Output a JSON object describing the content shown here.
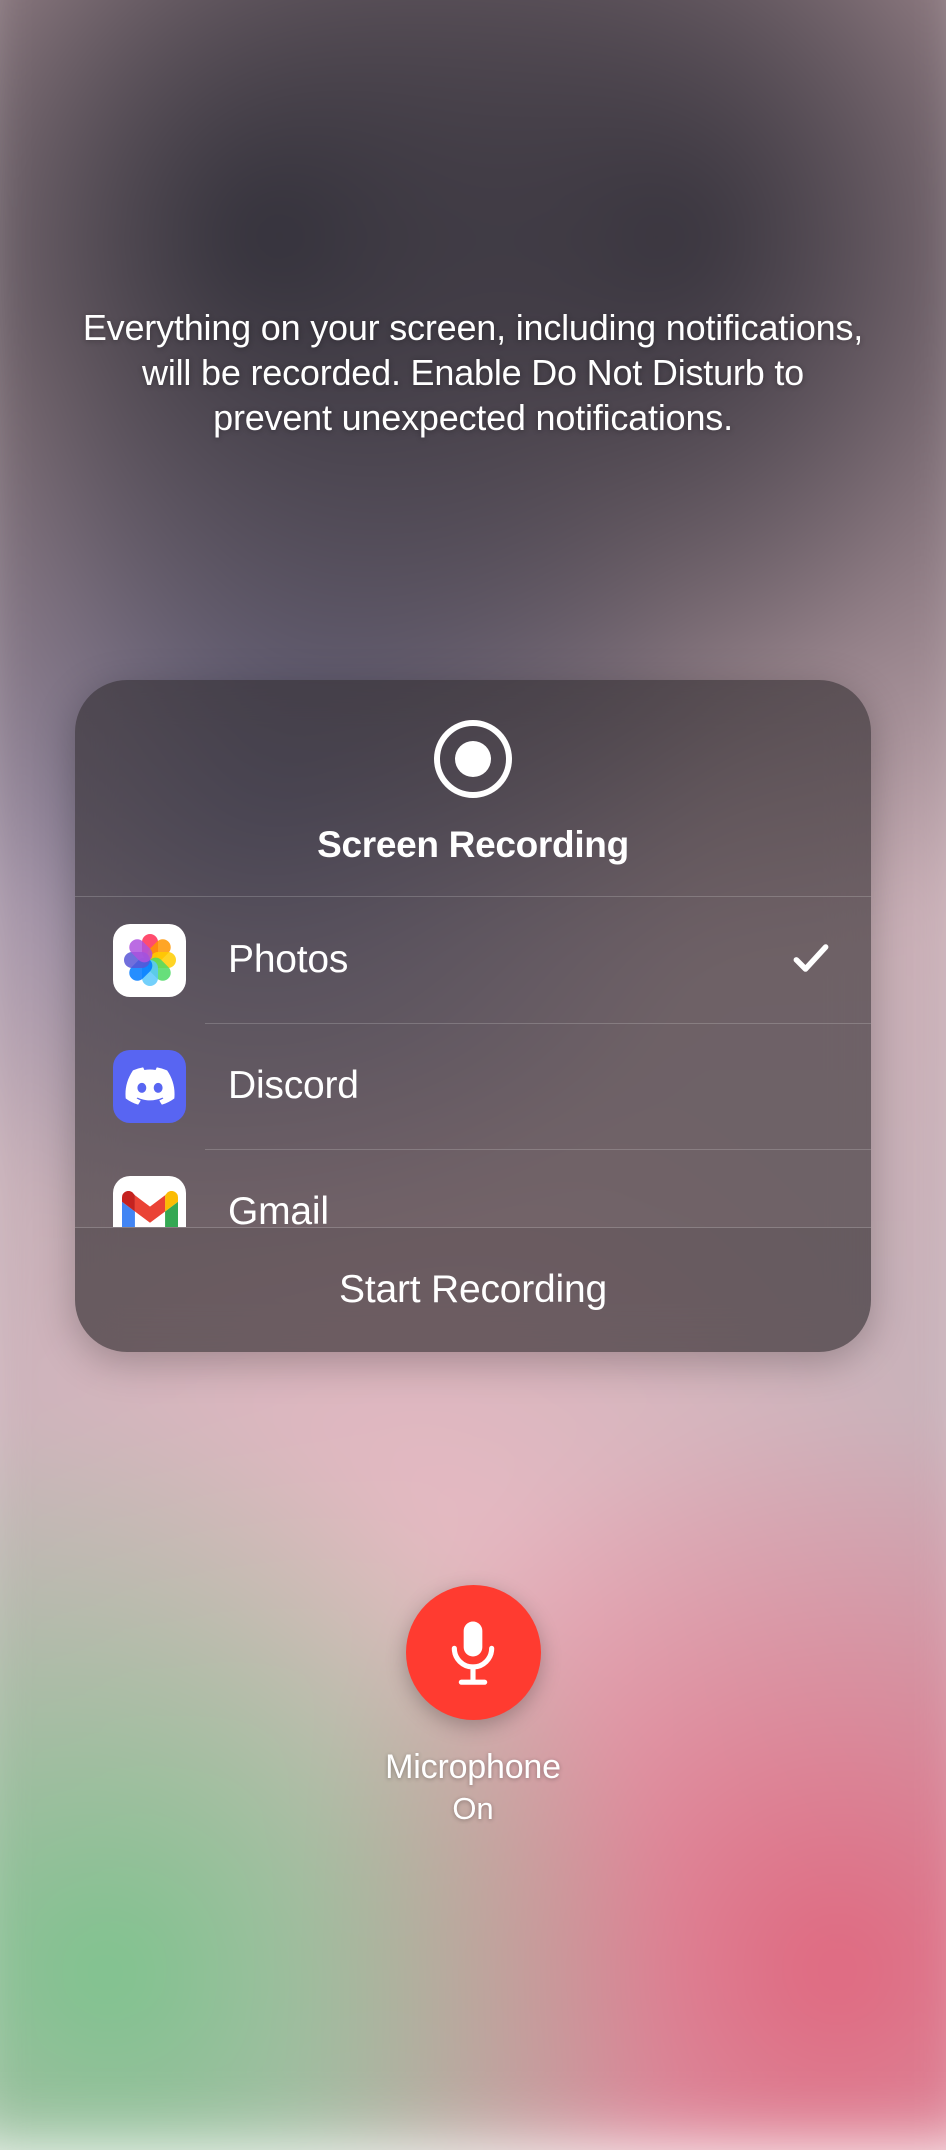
{
  "info_text": "Everything on your screen, including notifications, will be recorded. Enable Do Not Disturb to prevent unexpected notifications.",
  "panel": {
    "title": "Screen Recording",
    "apps": [
      {
        "name": "Photos",
        "icon": "photos-icon",
        "selected": true
      },
      {
        "name": "Discord",
        "icon": "discord-icon",
        "selected": false
      },
      {
        "name": "Gmail",
        "icon": "gmail-icon",
        "selected": false
      }
    ],
    "start_label": "Start Recording"
  },
  "microphone": {
    "label": "Microphone",
    "status": "On",
    "active_color": "#ff3b30"
  }
}
